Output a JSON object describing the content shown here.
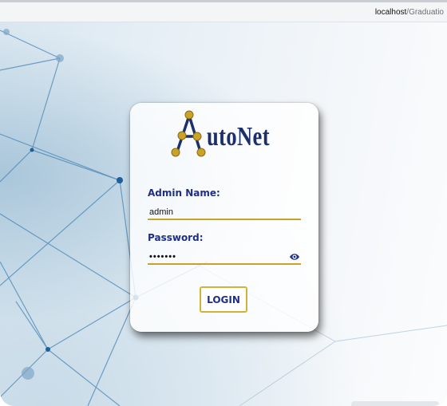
{
  "browser": {
    "url_host": "localhost",
    "url_path": "/Graduatio"
  },
  "logo": {
    "brand_name": "utoNet",
    "brand_letter": "A"
  },
  "form": {
    "admin_name_label": "Admin Name:",
    "admin_name_value": "admin",
    "password_label": "Password:",
    "password_value": "•••••••",
    "login_label": "LOGIN"
  },
  "colors": {
    "label_blue": "#1f2f86",
    "accent_gold": "#c9a227",
    "logo_navy": "#1b2f6b"
  },
  "icons": {
    "show_password": "eye-icon"
  }
}
